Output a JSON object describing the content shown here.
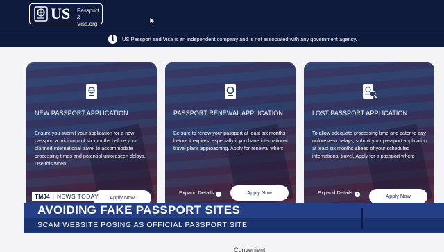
{
  "header": {
    "logo_us": "US",
    "logo_line1": "Passport",
    "logo_line2": "& Visa.org",
    "logo_icon": "globe-passport-icon"
  },
  "notice": {
    "icon": "info-icon",
    "text": "US Passport and Visa is an independent company and is not associated with any government agency."
  },
  "cards": [
    {
      "icon": "passport-book-icon",
      "title": "NEW PASSPORT APPLICATION",
      "body": "Ensure you submit your application for a new passport a minimum of six months before your planned international travel to accommodate processing times and potential unforeseen delays. Use this when:",
      "apply_label": "Apply Now"
    },
    {
      "icon": "passport-renew-icon",
      "title": "PASSPORT RENEWAL APPLICATION",
      "body": "Be sure to renew your passport at least six months before it expires, especially if you have international travel plans approaching. Apply for renewal when:",
      "expand_label": "Expand Details",
      "apply_label": "Apply Now"
    },
    {
      "icon": "lost-passport-icon",
      "title": "LOST PASSPORT APPLICATION",
      "body": "To allow adequate processing time and cater to any unforeseen delays, submit your passport application at least six months ahead of your scheduled international travel. Apply for a passport when:",
      "expand_label": "Expand Details",
      "apply_label": "Apply Now"
    }
  ],
  "news": {
    "station": "TMJ4",
    "tag": "NEWS TODAY",
    "headline": "AVOIDING FAKE PASSPORT SITES",
    "subhead": "SCAM WEBSITE POSING AS OFFICIAL PASSPORT SITE"
  },
  "bottom": {
    "partial_text": "Convenient"
  },
  "colors": {
    "navy": "#0f1b3d",
    "lower_third_blue": "#243f86",
    "card_bg": "#243563"
  }
}
